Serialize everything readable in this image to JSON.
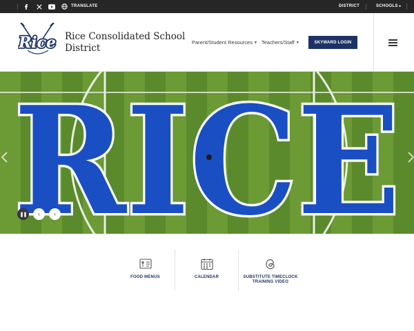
{
  "topbar": {
    "social": [
      "facebook-icon",
      "x-icon",
      "youtube-icon"
    ],
    "translate_label": "TRANSLATE",
    "district_label": "DISTRICT",
    "schools_label": "SCHOOLS"
  },
  "header": {
    "logo_text": "Rice",
    "district_name": "Rice Consolidated School District",
    "nav": [
      {
        "label": "Parent/Student Resources"
      },
      {
        "label": "Teachers/Staff"
      }
    ],
    "skyward_label": "SKYWARD LOGIN"
  },
  "hero": {
    "field_text": "RICE",
    "colors": {
      "grass": "#5f8f2e",
      "letters": "#1a4fc4",
      "outline": "#ffffff"
    }
  },
  "quick_links": [
    {
      "label": "FOOD MENUS",
      "icon": "food-menu-icon"
    },
    {
      "label": "CALENDAR",
      "icon": "calendar-icon"
    },
    {
      "label_line1": "SUBSTITUTE TIMECLOCK",
      "label_line2": "TRAINING VIDEO",
      "icon": "threads-icon"
    }
  ],
  "colors": {
    "brand": "#1d3366",
    "topbar": "#262626"
  }
}
